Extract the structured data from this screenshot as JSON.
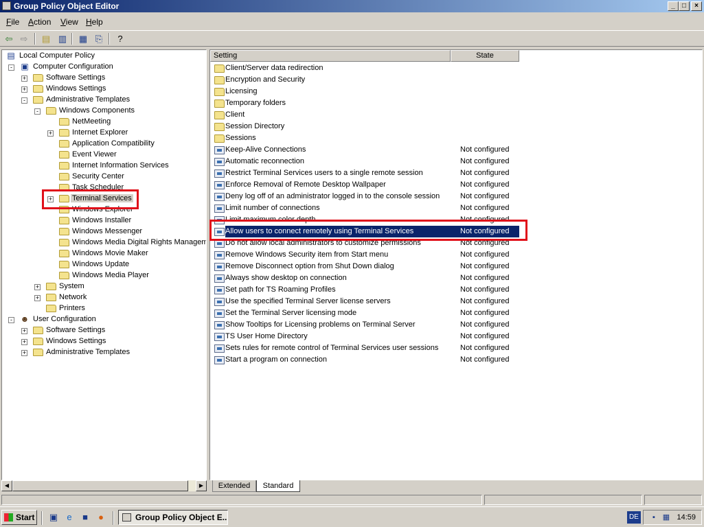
{
  "window": {
    "title": "Group Policy Object Editor",
    "buttons": {
      "minimize": "_",
      "maximize": "□",
      "close": "×"
    }
  },
  "menu": [
    {
      "label": "File",
      "accel": "F"
    },
    {
      "label": "Action",
      "accel": "A"
    },
    {
      "label": "View",
      "accel": "V"
    },
    {
      "label": "Help",
      "accel": "H"
    }
  ],
  "toolbar": {
    "icons": [
      "back-arrow-icon",
      "forward-arrow-icon",
      "up-folder-icon",
      "show-hide-tree-icon",
      "properties-icon",
      "export-list-icon",
      "help-icon"
    ]
  },
  "tree": [
    {
      "label": "Local Computer Policy",
      "level": 0,
      "icon": "policy",
      "exp": ""
    },
    {
      "label": "Computer Configuration",
      "level": 1,
      "icon": "computer",
      "exp": "-"
    },
    {
      "label": "Software Settings",
      "level": 2,
      "icon": "folder",
      "exp": "+"
    },
    {
      "label": "Windows Settings",
      "level": 2,
      "icon": "folder",
      "exp": "+"
    },
    {
      "label": "Administrative Templates",
      "level": 2,
      "icon": "folder",
      "exp": "-"
    },
    {
      "label": "Windows Components",
      "level": 3,
      "icon": "folder",
      "exp": "-"
    },
    {
      "label": "NetMeeting",
      "level": 4,
      "icon": "folder",
      "exp": ""
    },
    {
      "label": "Internet Explorer",
      "level": 4,
      "icon": "folder",
      "exp": "+"
    },
    {
      "label": "Application Compatibility",
      "level": 4,
      "icon": "folder",
      "exp": ""
    },
    {
      "label": "Event Viewer",
      "level": 4,
      "icon": "folder",
      "exp": ""
    },
    {
      "label": "Internet Information Services",
      "level": 4,
      "icon": "folder",
      "exp": ""
    },
    {
      "label": "Security Center",
      "level": 4,
      "icon": "folder",
      "exp": ""
    },
    {
      "label": "Task Scheduler",
      "level": 4,
      "icon": "folder",
      "exp": ""
    },
    {
      "label": "Terminal Services",
      "level": 4,
      "icon": "folder",
      "exp": "+",
      "selected": true
    },
    {
      "label": "Windows Explorer",
      "level": 4,
      "icon": "folder",
      "exp": ""
    },
    {
      "label": "Windows Installer",
      "level": 4,
      "icon": "folder",
      "exp": ""
    },
    {
      "label": "Windows Messenger",
      "level": 4,
      "icon": "folder",
      "exp": ""
    },
    {
      "label": "Windows Media Digital Rights Managemen",
      "level": 4,
      "icon": "folder",
      "exp": ""
    },
    {
      "label": "Windows Movie Maker",
      "level": 4,
      "icon": "folder",
      "exp": ""
    },
    {
      "label": "Windows Update",
      "level": 4,
      "icon": "folder",
      "exp": ""
    },
    {
      "label": "Windows Media Player",
      "level": 4,
      "icon": "folder",
      "exp": ""
    },
    {
      "label": "System",
      "level": 3,
      "icon": "folder",
      "exp": "+"
    },
    {
      "label": "Network",
      "level": 3,
      "icon": "folder",
      "exp": "+"
    },
    {
      "label": "Printers",
      "level": 3,
      "icon": "folder",
      "exp": ""
    },
    {
      "label": "User Configuration",
      "level": 1,
      "icon": "user",
      "exp": "-"
    },
    {
      "label": "Software Settings",
      "level": 2,
      "icon": "folder",
      "exp": "+"
    },
    {
      "label": "Windows Settings",
      "level": 2,
      "icon": "folder",
      "exp": "+"
    },
    {
      "label": "Administrative Templates",
      "level": 2,
      "icon": "folder",
      "exp": "+"
    }
  ],
  "list": {
    "columns": [
      "Setting",
      "State"
    ],
    "rows": [
      {
        "name": "Client/Server data redirection",
        "state": "",
        "type": "folder"
      },
      {
        "name": "Encryption and Security",
        "state": "",
        "type": "folder"
      },
      {
        "name": "Licensing",
        "state": "",
        "type": "folder"
      },
      {
        "name": "Temporary folders",
        "state": "",
        "type": "folder"
      },
      {
        "name": "Client",
        "state": "",
        "type": "folder"
      },
      {
        "name": "Session Directory",
        "state": "",
        "type": "folder"
      },
      {
        "name": "Sessions",
        "state": "",
        "type": "folder"
      },
      {
        "name": "Keep-Alive Connections",
        "state": "Not configured",
        "type": "policy"
      },
      {
        "name": "Automatic reconnection",
        "state": "Not configured",
        "type": "policy"
      },
      {
        "name": "Restrict Terminal Services users to a single remote session",
        "state": "Not configured",
        "type": "policy"
      },
      {
        "name": "Enforce Removal of Remote Desktop Wallpaper",
        "state": "Not configured",
        "type": "policy"
      },
      {
        "name": "Deny log off of an administrator logged in to the console session",
        "state": "Not configured",
        "type": "policy"
      },
      {
        "name": "Limit number of connections",
        "state": "Not configured",
        "type": "policy"
      },
      {
        "name": "Limit maximum color depth",
        "state": "Not configured",
        "type": "policy"
      },
      {
        "name": "Allow users to connect remotely using Terminal Services",
        "state": "Not configured",
        "type": "policy",
        "selected": true
      },
      {
        "name": "Do not allow local administrators to customize permissions",
        "state": "Not configured",
        "type": "policy"
      },
      {
        "name": "Remove Windows Security item from Start menu",
        "state": "Not configured",
        "type": "policy"
      },
      {
        "name": "Remove Disconnect option from Shut Down dialog",
        "state": "Not configured",
        "type": "policy"
      },
      {
        "name": "Always show desktop on connection",
        "state": "Not configured",
        "type": "policy"
      },
      {
        "name": "Set path for TS Roaming Profiles",
        "state": "Not configured",
        "type": "policy"
      },
      {
        "name": "Use the specified Terminal Server license servers",
        "state": "Not configured",
        "type": "policy"
      },
      {
        "name": "Set the Terminal Server licensing mode",
        "state": "Not configured",
        "type": "policy"
      },
      {
        "name": "Show Tooltips for Licensing problems on Terminal Server",
        "state": "Not configured",
        "type": "policy"
      },
      {
        "name": "TS User Home Directory",
        "state": "Not configured",
        "type": "policy"
      },
      {
        "name": "Sets rules for remote control of Terminal Services user sessions",
        "state": "Not configured",
        "type": "policy"
      },
      {
        "name": "Start a program on connection",
        "state": "Not configured",
        "type": "policy"
      }
    ]
  },
  "tabs": [
    {
      "label": "Extended",
      "active": false
    },
    {
      "label": "Standard",
      "active": true
    }
  ],
  "taskbar": {
    "start_label": "Start",
    "task_label": "Group Policy Object E...",
    "language": "DE",
    "clock": "14:59",
    "quicklaunch": [
      "show-desktop-icon",
      "internet-explorer-icon",
      "save-icon",
      "firefox-icon"
    ]
  },
  "colors": {
    "highlight": "#e0101a",
    "selection": "#0a246a",
    "titlebar_start": "#0a246a"
  }
}
